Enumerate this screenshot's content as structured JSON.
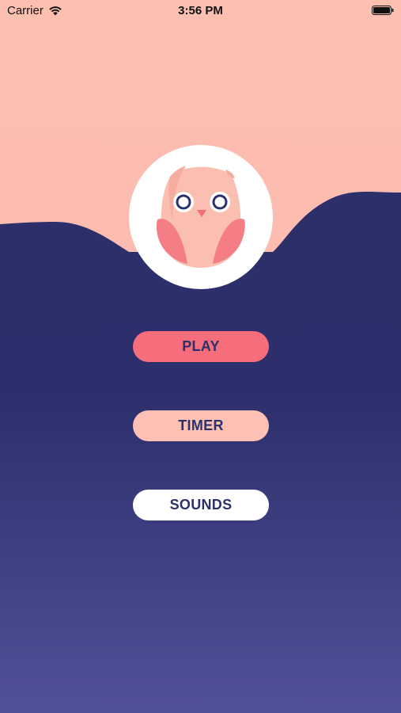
{
  "status_bar": {
    "carrier": "Carrier",
    "time": "3:56 PM",
    "icons": [
      "wifi-icon",
      "battery-icon"
    ]
  },
  "avatar": {
    "icon": "owl-icon"
  },
  "menu": {
    "play_label": "PLAY",
    "timer_label": "TIMER",
    "sounds_label": "SOUNDS"
  },
  "colors": {
    "top_background": "#fbbfb1",
    "bottom_background": "#2c2f6b",
    "bottom_gradient_end": "#51509a",
    "play_button": "#f66d7c",
    "timer_button": "#fcc1b4",
    "sounds_button": "#ffffff",
    "button_text": "#2d316b"
  }
}
